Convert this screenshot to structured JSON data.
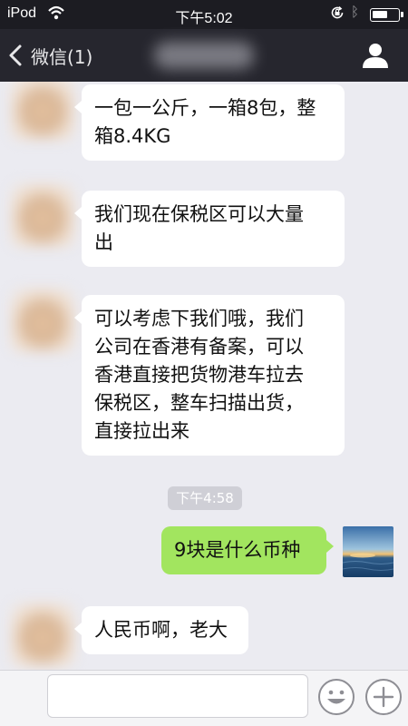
{
  "status_bar": {
    "carrier": "iPod",
    "time": "下午5:02"
  },
  "nav": {
    "back_label": "微信(1)"
  },
  "messages": [
    {
      "side": "left",
      "text": "一包一公斤，一箱8包，整\n箱8.4KG"
    },
    {
      "side": "left",
      "text": "我们现在保税区可以大量\n出"
    },
    {
      "side": "left",
      "text": "可以考虑下我们哦，我们\n公司在香港有备案，可以\n香港直接把货物港车拉去\n保税区，整车扫描出货，\n直接拉出来"
    },
    {
      "side": "right",
      "text": "9块是什么币种"
    },
    {
      "side": "left",
      "text": "人民币啊，老大"
    }
  ],
  "timestamp": "下午4:58",
  "icons": {
    "wifi": "wifi-icon",
    "lock": "orientation-lock-icon",
    "bluetooth": "bluetooth-icon",
    "battery": "battery-icon",
    "back": "chevron-left-icon",
    "profile": "person-icon",
    "emoji": "smiley-icon",
    "plus": "plus-icon"
  },
  "colors": {
    "nav_bg": "#26262e",
    "chat_bg": "#ebebf1",
    "incoming_bubble": "#ffffff",
    "outgoing_bubble": "#a2e55f"
  }
}
